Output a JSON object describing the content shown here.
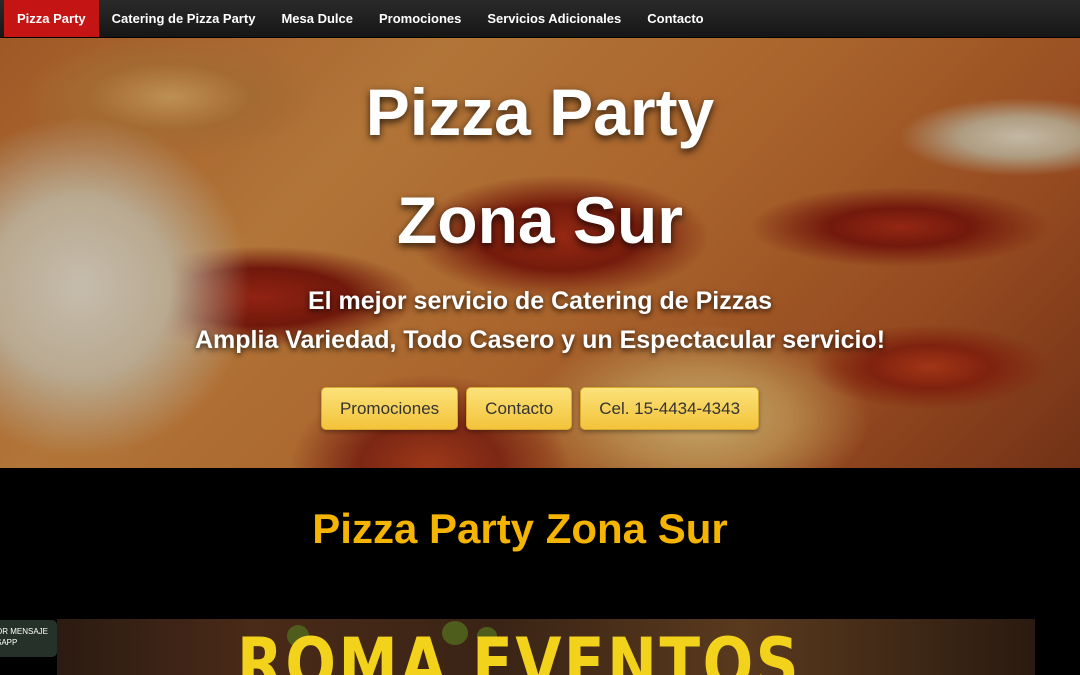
{
  "nav": {
    "items": [
      {
        "label": "Pizza Party",
        "active": true
      },
      {
        "label": "Catering de Pizza Party"
      },
      {
        "label": "Mesa Dulce"
      },
      {
        "label": "Promociones"
      },
      {
        "label": "Servicios Adicionales"
      },
      {
        "label": "Contacto"
      }
    ]
  },
  "hero": {
    "title_line1": "Pizza Party",
    "title_line2": "Zona Sur",
    "subtitle_line1": "El mejor servicio de Catering de Pizzas",
    "subtitle_line2": "Amplia Variedad, Todo Casero y un Espectacular servicio!",
    "buttons": [
      {
        "label": "Promociones"
      },
      {
        "label": "Contacto"
      },
      {
        "label": "Cel. 15-4434-4343"
      }
    ]
  },
  "section": {
    "title": "Pizza Party Zona Sur"
  },
  "banner": {
    "text": "ROMA EVENTOS"
  },
  "whatsapp": {
    "line1": "OR MENSAJE",
    "line2": "SAPP"
  },
  "colors": {
    "nav_active": "#c41414",
    "button": "#f6cf4f",
    "section_title": "#f5b400",
    "banner_text": "#f2d21b"
  }
}
